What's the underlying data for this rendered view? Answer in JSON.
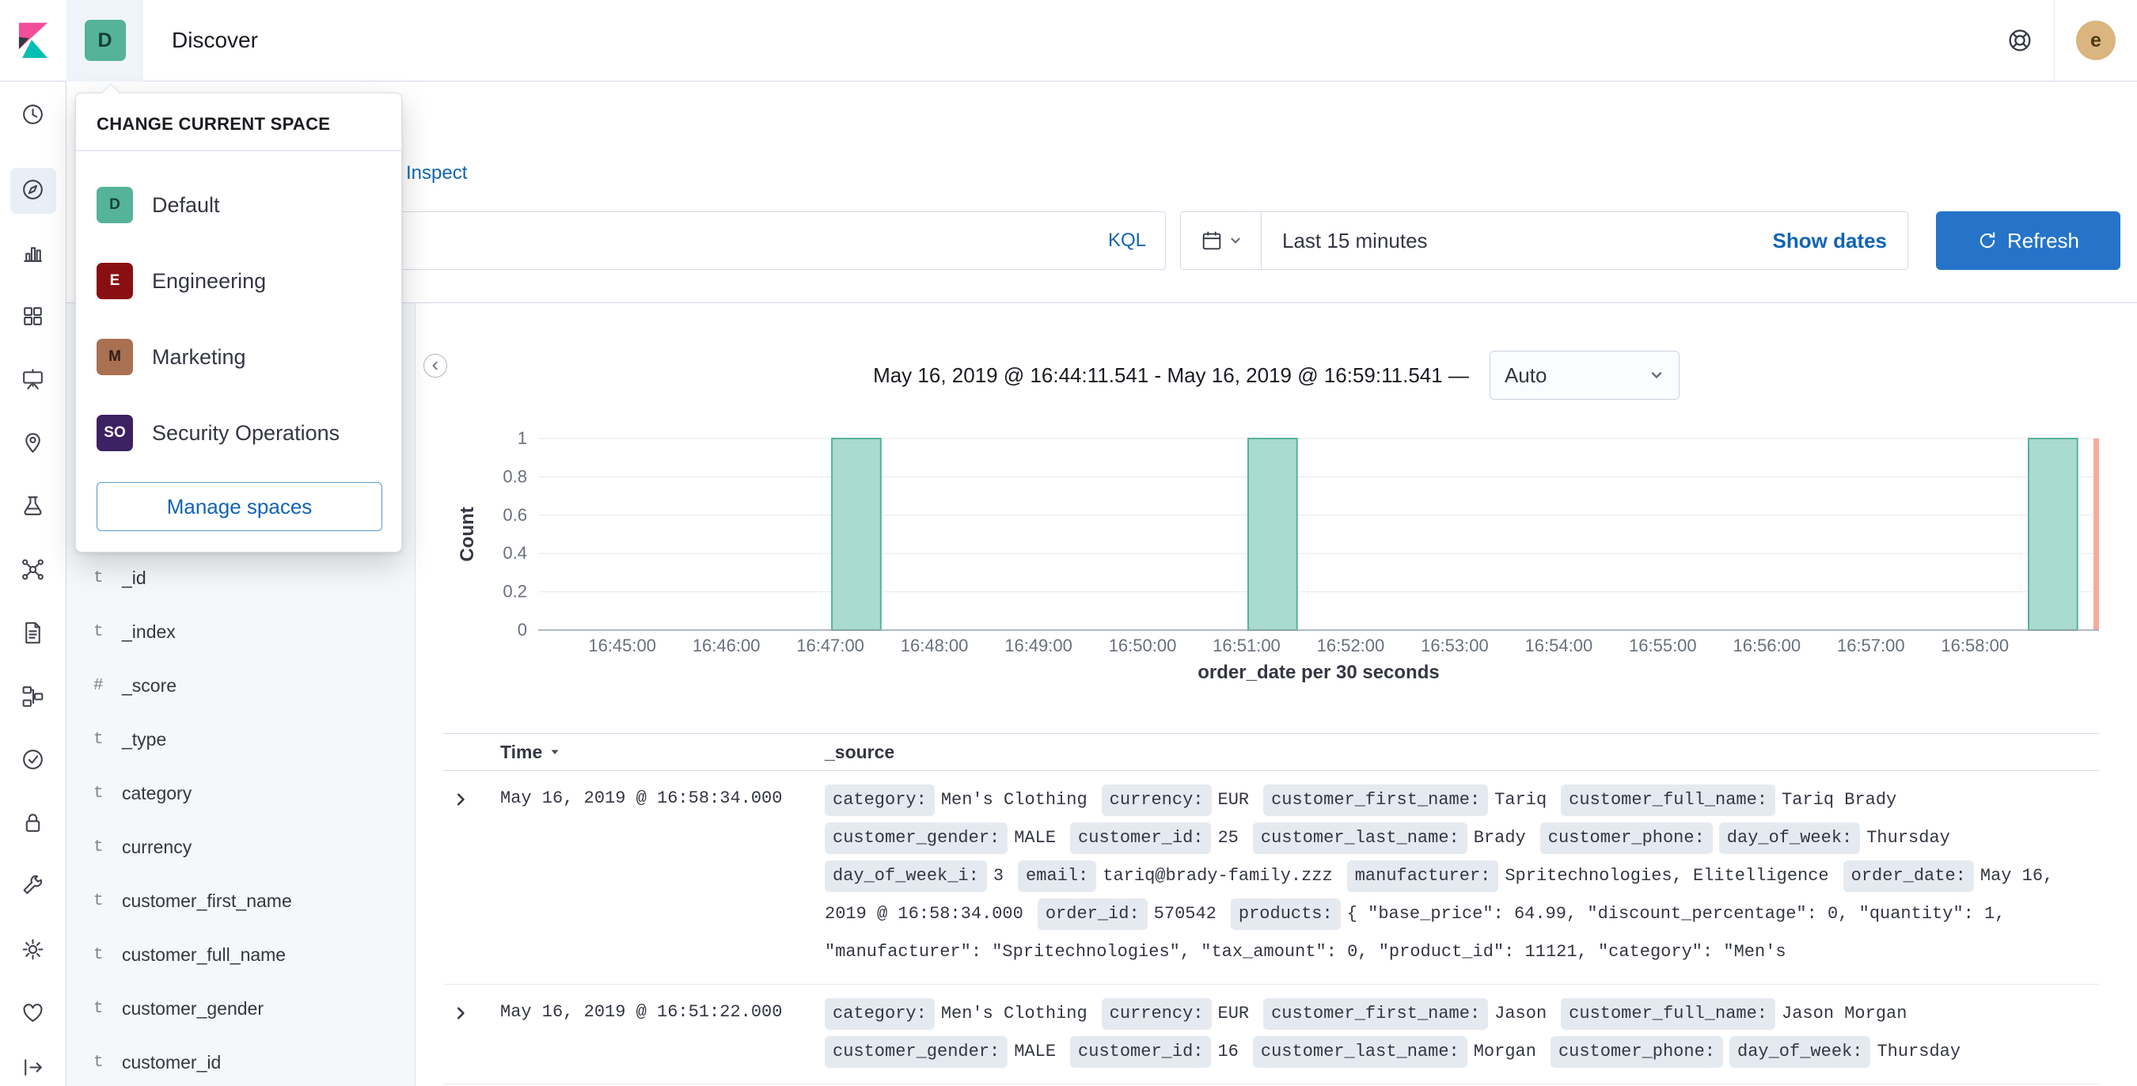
{
  "header": {
    "breadcrumb": "Discover",
    "space_initial": "D",
    "user_initial": "e"
  },
  "left_nav": {
    "items": [
      {
        "name": "recently-viewed",
        "icon": "clock",
        "active": false
      },
      {
        "name": "discover",
        "icon": "compass",
        "active": true
      },
      {
        "name": "visualize",
        "icon": "bar-chart",
        "active": false
      },
      {
        "name": "dashboard",
        "icon": "grid",
        "active": false
      },
      {
        "name": "canvas",
        "icon": "easel",
        "active": false
      },
      {
        "name": "maps",
        "icon": "map-pin",
        "active": false
      },
      {
        "name": "machine-learning",
        "icon": "flask",
        "active": false
      },
      {
        "name": "infrastructure",
        "icon": "nodes",
        "active": false
      },
      {
        "name": "logs",
        "icon": "document",
        "active": false
      },
      {
        "name": "apm",
        "icon": "hierarchy",
        "active": false
      },
      {
        "name": "uptime",
        "icon": "check-circle",
        "active": false
      },
      {
        "name": "siem",
        "icon": "lock",
        "active": false
      },
      {
        "name": "dev-tools",
        "icon": "wrench",
        "active": false
      },
      {
        "name": "stack-management",
        "icon": "gear",
        "active": false
      },
      {
        "name": "monitoring",
        "icon": "heart",
        "active": false
      },
      {
        "name": "collapse",
        "icon": "collapse-arrow",
        "active": false
      }
    ]
  },
  "space_popover": {
    "title": "CHANGE CURRENT SPACE",
    "spaces": [
      {
        "initial": "D",
        "name": "Default",
        "color": "#54B399",
        "text_color": "#143F36"
      },
      {
        "initial": "E",
        "name": "Engineering",
        "color": "#8A0F12",
        "text_color": "#FFFFFF"
      },
      {
        "initial": "M",
        "name": "Marketing",
        "color": "#AA7052",
        "text_color": "#2F1D15"
      },
      {
        "initial": "SO",
        "name": "Security Operations",
        "color": "#3C2163",
        "text_color": "#FFFFFF"
      }
    ],
    "manage_button": "Manage spaces"
  },
  "toolbar": {
    "inspect": "Inspect"
  },
  "query_bar": {
    "value": "",
    "language_label": "KQL"
  },
  "time_picker": {
    "value": "Last 15 minutes",
    "show_dates": "Show dates"
  },
  "refresh": {
    "label": "Refresh"
  },
  "fields_sidebar": {
    "fields": [
      {
        "type": "t",
        "name": "_id"
      },
      {
        "type": "t",
        "name": "_index"
      },
      {
        "type": "#",
        "name": "_score"
      },
      {
        "type": "t",
        "name": "_type"
      },
      {
        "type": "t",
        "name": "category"
      },
      {
        "type": "t",
        "name": "currency"
      },
      {
        "type": "t",
        "name": "customer_first_name"
      },
      {
        "type": "t",
        "name": "customer_full_name"
      },
      {
        "type": "t",
        "name": "customer_gender"
      },
      {
        "type": "t",
        "name": "customer_id"
      }
    ]
  },
  "histogram": {
    "title_display": "May 16, 2019 @ 16:44:11.541 - May 16, 2019 @ 16:59:11.541 —",
    "interval_value": "Auto"
  },
  "chart_data": {
    "type": "bar",
    "title": "May 16, 2019 @ 16:44:11.541 - May 16, 2019 @ 16:59:11.541",
    "xlabel": "order_date per 30 seconds",
    "ylabel": "Count",
    "ylim": [
      0,
      1
    ],
    "y_ticks": [
      0,
      0.2,
      0.4,
      0.6,
      0.8,
      1
    ],
    "x_domain_start": "16:44:11.541",
    "x_domain_end": "16:59:11.541",
    "x_tick_labels": [
      "16:45:00",
      "16:46:00",
      "16:47:00",
      "16:48:00",
      "16:49:00",
      "16:50:00",
      "16:51:00",
      "16:52:00",
      "16:53:00",
      "16:54:00",
      "16:55:00",
      "16:56:00",
      "16:57:00",
      "16:58:00"
    ],
    "bucket_interval_seconds": 30,
    "buckets": [
      {
        "x": "16:47:00",
        "count": 1
      },
      {
        "x": "16:51:00",
        "count": 1
      },
      {
        "x": "16:58:30",
        "count": 1
      }
    ],
    "time_marker": "16:59:11.541",
    "colors": {
      "bar_fill": "#A9DBD1",
      "bar_stroke": "#54B399",
      "marker": "#FBA99C"
    },
    "grid": true,
    "legend": "none"
  },
  "doc_table": {
    "columns": {
      "time": "Time",
      "source": "_source"
    },
    "rows": [
      {
        "time": "May 16, 2019 @ 16:58:34.000",
        "source": [
          [
            "category",
            "Men's Clothing"
          ],
          [
            "currency",
            "EUR"
          ],
          [
            "customer_first_name",
            "Tariq"
          ],
          [
            "customer_full_name",
            "Tariq Brady"
          ],
          [
            "customer_gender",
            "MALE"
          ],
          [
            "customer_id",
            "25"
          ],
          [
            "customer_last_name",
            "Brady"
          ],
          [
            "customer_phone",
            ""
          ],
          [
            "day_of_week",
            "Thursday"
          ],
          [
            "day_of_week_i",
            "3"
          ],
          [
            "email",
            "tariq@brady-family.zzz"
          ],
          [
            "manufacturer",
            "Spritechnologies, Elitelligence"
          ],
          [
            "order_date",
            "May 16, 2019 @ 16:58:34.000"
          ],
          [
            "order_id",
            "570542"
          ],
          [
            "products",
            "{ \"base_price\": 64.99, \"discount_percentage\": 0, \"quantity\": 1, \"manufacturer\": \"Spritechnologies\", \"tax_amount\": 0, \"product_id\": 11121, \"category\": \"Men's"
          ]
        ]
      },
      {
        "time": "May 16, 2019 @ 16:51:22.000",
        "source": [
          [
            "category",
            "Men's Clothing"
          ],
          [
            "currency",
            "EUR"
          ],
          [
            "customer_first_name",
            "Jason"
          ],
          [
            "customer_full_name",
            "Jason Morgan"
          ],
          [
            "customer_gender",
            "MALE"
          ],
          [
            "customer_id",
            "16"
          ],
          [
            "customer_last_name",
            "Morgan"
          ],
          [
            "customer_phone",
            ""
          ],
          [
            "day_of_week",
            "Thursday"
          ]
        ]
      }
    ]
  }
}
